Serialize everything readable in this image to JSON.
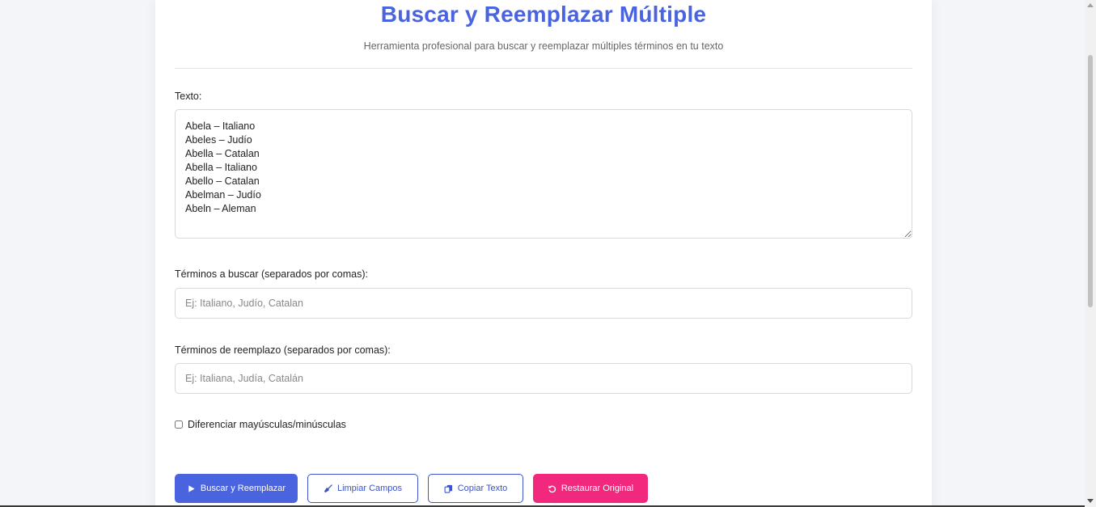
{
  "header": {
    "title": "Buscar y Reemplazar Múltiple",
    "subtitle": "Herramienta profesional para buscar y reemplazar múltiples términos en tu texto"
  },
  "text_field": {
    "label": "Texto:",
    "value": "Abela – Italiano\nAbeles – Judío\nAbella – Catalan\nAbella – Italiano\nAbello – Catalan\nAbelman – Judío\nAbeln – Aleman"
  },
  "search_field": {
    "label": "Términos a buscar (separados por comas):",
    "value": "",
    "placeholder": "Ej: Italiano, Judío, Catalan"
  },
  "replace_field": {
    "label": "Términos de reemplazo (separados por comas):",
    "value": "",
    "placeholder": "Ej: Italiana, Judía, Catalán"
  },
  "case_option": {
    "label": "Diferenciar mayúsculas/minúsculas",
    "checked": false
  },
  "buttons": {
    "search_replace": {
      "label": "Buscar y Reemplazar",
      "icon": "play-icon"
    },
    "clear": {
      "label": "Limpiar Campos",
      "icon": "broom-icon"
    },
    "copy": {
      "label": "Copiar Texto",
      "icon": "copy-icon"
    },
    "restore": {
      "label": "Restaurar Original",
      "icon": "undo-icon"
    }
  },
  "colors": {
    "primary": "#4a63df",
    "outline": "#3c53c9",
    "restore": "#f2277e",
    "title": "#4a63df"
  }
}
